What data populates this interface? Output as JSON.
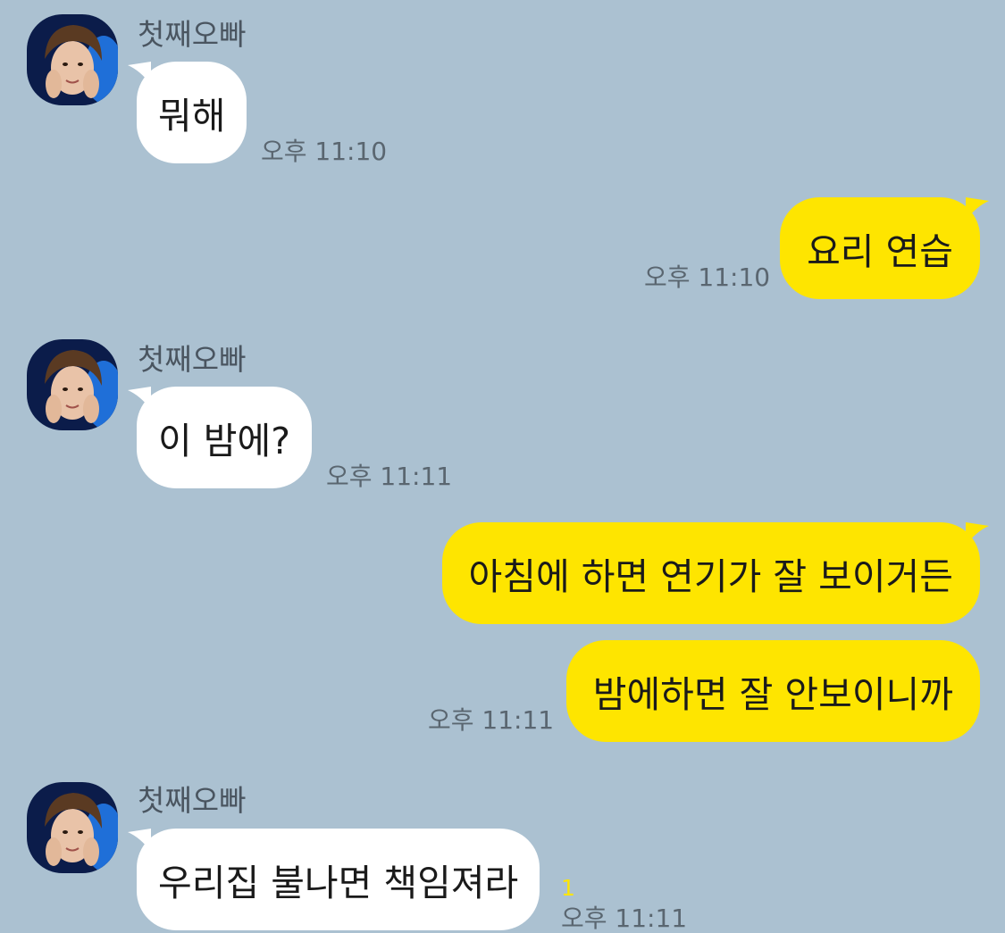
{
  "colors": {
    "background": "#abc1d1",
    "incoming_bubble": "#ffffff",
    "outgoing_bubble": "#fee500",
    "unread_count": "#fee500"
  },
  "chat": {
    "sender_name": "첫째오빠",
    "avatar_icon": "profile-photo",
    "messages": [
      {
        "direction": "in",
        "text": "뭐해",
        "time": "오후 11:10"
      },
      {
        "direction": "out",
        "text": "요리 연습",
        "time": "오후 11:10"
      },
      {
        "direction": "in",
        "text": "이 밤에?",
        "time": "오후 11:11"
      },
      {
        "direction": "out",
        "text": "아침에 하면 연기가 잘 보이거든",
        "time": ""
      },
      {
        "direction": "out",
        "text": "밤에하면 잘 안보이니까",
        "time": "오후 11:11"
      },
      {
        "direction": "in",
        "text": "우리집 불나면 책임져라",
        "time": "오후 11:11",
        "unread": "1"
      }
    ]
  }
}
